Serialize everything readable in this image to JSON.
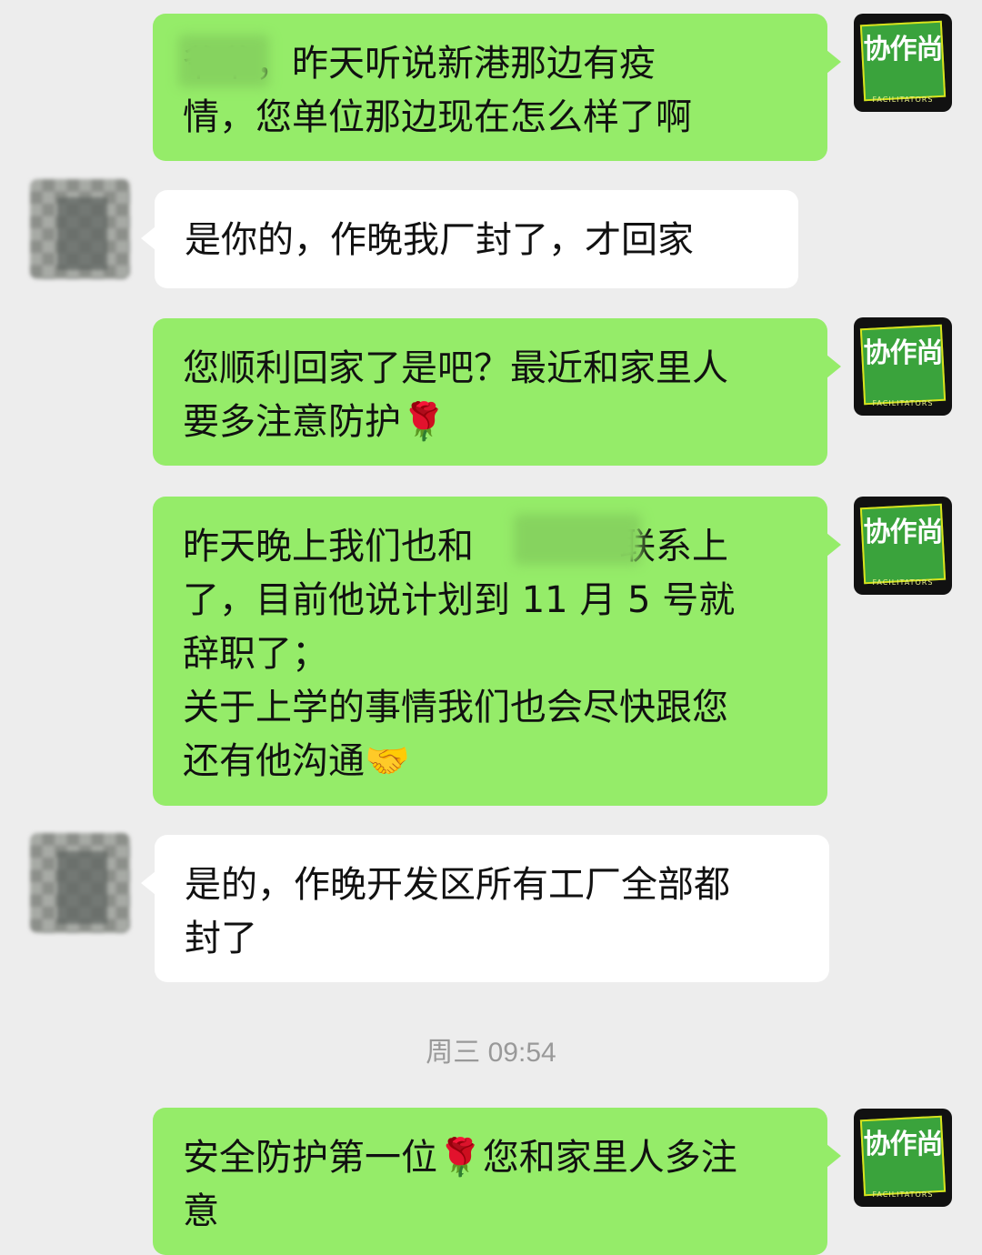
{
  "chat": {
    "messages": [
      {
        "side": "out",
        "text": "爷爷，昨天听说新港那边有疫\n情，您单位那边现在怎么样了啊"
      },
      {
        "side": "in",
        "text": "是你的，作晚我厂封了，才回家"
      },
      {
        "side": "out",
        "text": "您顺利回家了是吧？最近和家里人\n要多注意防护🌹"
      },
      {
        "side": "out",
        "text": "昨天晚上我们也和　　　　联系上\n了，目前他说计划到 11 月 5 号就\n辞职了；\n关于上学的事情我们也会尽快跟您\n还有他沟通🤝"
      },
      {
        "side": "in",
        "text": "是的，作晚开发区所有工厂全部都\n封了"
      },
      {
        "side": "out",
        "text": "安全防护第一位🌹您和家里人多注\n意"
      }
    ],
    "timestamp": "周三 09:54"
  },
  "avatar": {
    "logo_text": "协作尚",
    "logo_sub": "FACILITATORS"
  },
  "colors": {
    "outgoing_bubble": "#95ec69",
    "incoming_bubble": "#ffffff",
    "background": "#ededed"
  }
}
